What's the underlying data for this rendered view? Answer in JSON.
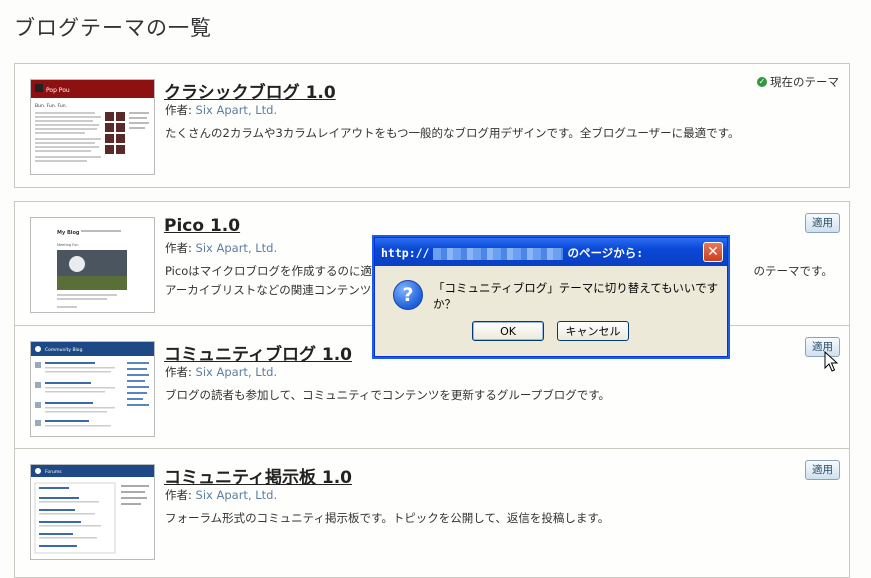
{
  "page": {
    "title": "ブログテーマの一覧"
  },
  "themes": [
    {
      "name": "クラシックブログ 1.0",
      "author_label": "作者:",
      "author": "Six Apart, Ltd.",
      "description": "たくさんの2カラムや3カラムレイアウトをもつ一般的なブログ用デザインです。全ブログユーザーに最適です。",
      "status": "現在のテーマ",
      "thumb_title": "Pop Pou",
      "thumb_subtitle": "Bun. Fun. Fun."
    },
    {
      "name": "Pico 1.0",
      "author_label": "作者:",
      "author": "Six Apart, Ltd.",
      "description": "Picoはマイクロブログを作成するのに適し",
      "description_tail": "のテーマです。アーカイブリストなどの関連コンテンツは、メイ",
      "apply": "適用",
      "thumb_title": "My Blog",
      "thumb_subtitle": "Meeting Fun"
    },
    {
      "name": "コミュニティブログ 1.0",
      "author_label": "作者:",
      "author": "Six Apart, Ltd.",
      "description": "ブログの読者も参加して、コミュニティでコンテンツを更新するグループブログです。",
      "apply": "適用",
      "thumb_title": "Community Blog"
    },
    {
      "name": "コミュニティ掲示板 1.0",
      "author_label": "作者:",
      "author": "Six Apart, Ltd.",
      "description": "フォーラム形式のコミュニティ掲示板です。トピックを公開して、返信を投稿します。",
      "apply": "適用",
      "thumb_title": "Forums"
    }
  ],
  "dialog": {
    "title_prefix": "http://",
    "title_suffix": "のページから:",
    "message": "「コミュニティブログ」テーマに切り替えてもいいですか？",
    "ok": "OK",
    "cancel": "キャンセル",
    "close_glyph": "✕",
    "question_glyph": "?"
  },
  "icons": {
    "check": "✓"
  }
}
